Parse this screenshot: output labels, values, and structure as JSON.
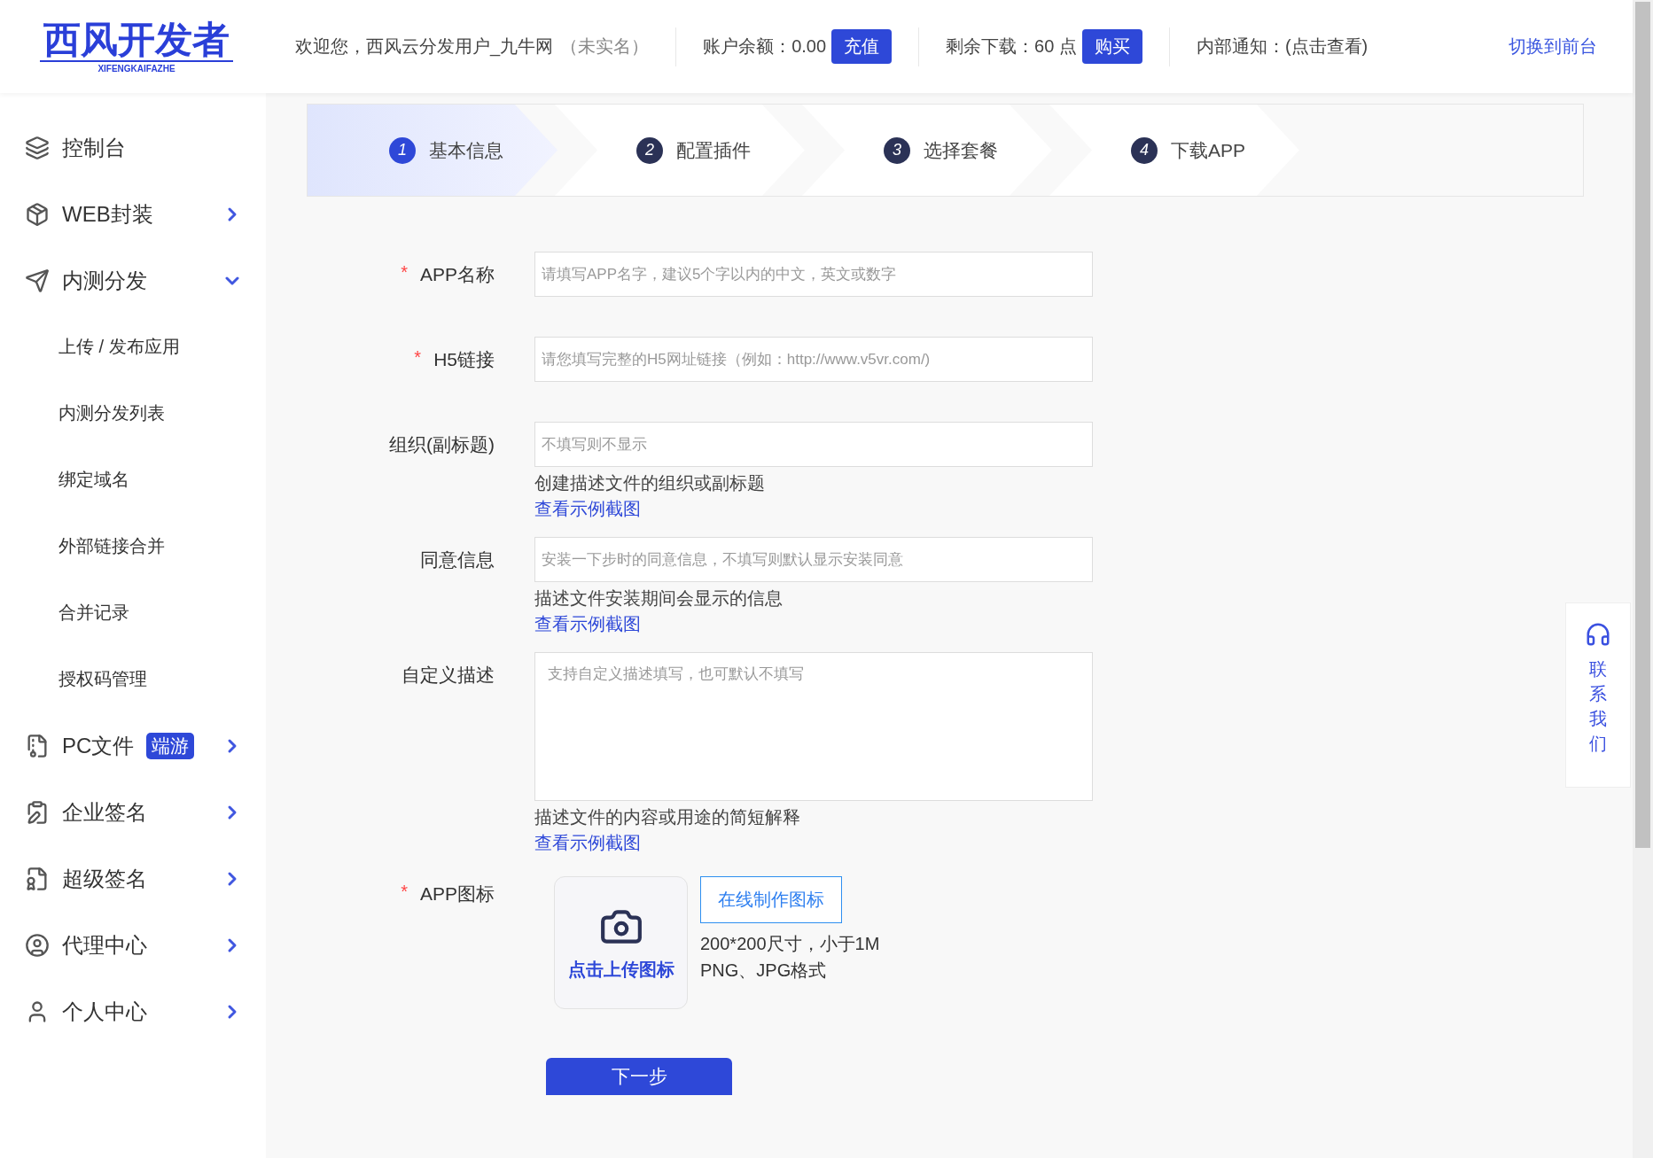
{
  "logo": {
    "title": "西风开发者",
    "subtitle": "XIFENGKAIFAZHE"
  },
  "header": {
    "welcome": "欢迎您，西风云分发用户_九牛网",
    "verify": "（未实名）",
    "balance": "账户余额：0.00",
    "recharge": "充值",
    "downloads": "剩余下载：60 点",
    "buy": "购买",
    "notice": "内部通知：(点击查看)",
    "switch": "切换到前台"
  },
  "sidebar": {
    "items": [
      {
        "label": "控制台"
      },
      {
        "label": "WEB封装",
        "expanded": false
      },
      {
        "label": "内测分发",
        "expanded": true,
        "children": [
          {
            "label": "上传 / 发布应用"
          },
          {
            "label": "内测分发列表"
          },
          {
            "label": "绑定域名"
          },
          {
            "label": "外部链接合并"
          },
          {
            "label": "合并记录"
          },
          {
            "label": "授权码管理"
          }
        ]
      },
      {
        "label": "PC文件",
        "badge": "端游",
        "expanded": false
      },
      {
        "label": "企业签名",
        "expanded": false
      },
      {
        "label": "超级签名",
        "expanded": false
      },
      {
        "label": "代理中心",
        "expanded": false
      },
      {
        "label": "个人中心",
        "expanded": false
      }
    ]
  },
  "steps": [
    {
      "number": "1",
      "label": "基本信息",
      "selected": true
    },
    {
      "number": "2",
      "label": "配置插件",
      "selected": false
    },
    {
      "number": "3",
      "label": "选择套餐",
      "selected": false
    },
    {
      "number": "4",
      "label": "下载APP",
      "selected": false
    }
  ],
  "form": {
    "fields": [
      {
        "kind": "input",
        "label": "APP名称",
        "required_mark": "*",
        "placeholder": "请填写APP名字，建议5个字以内的中文，英文或数字"
      },
      {
        "kind": "input",
        "label": "H5链接",
        "required_mark": "*",
        "placeholder": "请您填写完整的H5网址链接（例如：http://www.v5vr.com/)"
      },
      {
        "kind": "input",
        "label": "组织(副标题)",
        "placeholder": "不填写则不显示",
        "hint": "创建描述文件的组织或副标题",
        "link": "查看示例截图"
      },
      {
        "kind": "input",
        "label": "同意信息",
        "placeholder": "安装一下步时的同意信息，不填写则默认显示安装同意",
        "hint": "描述文件安装期间会显示的信息",
        "link": "查看示例截图"
      },
      {
        "kind": "textarea",
        "label": "自定义描述",
        "placeholder": "支持自定义描述填写，也可默认不填写",
        "hint": "描述文件的内容或用途的简短解释",
        "link": "查看示例截图"
      },
      {
        "kind": "upload",
        "label": "APP图标",
        "required_mark": "*",
        "upload_text": "点击上传图标",
        "make_button": "在线制作图标",
        "notes": [
          "200*200尺寸，小于1M",
          "PNG、JPG格式"
        ]
      }
    ],
    "next": "下一步"
  },
  "contact": {
    "label": "联系我们"
  }
}
